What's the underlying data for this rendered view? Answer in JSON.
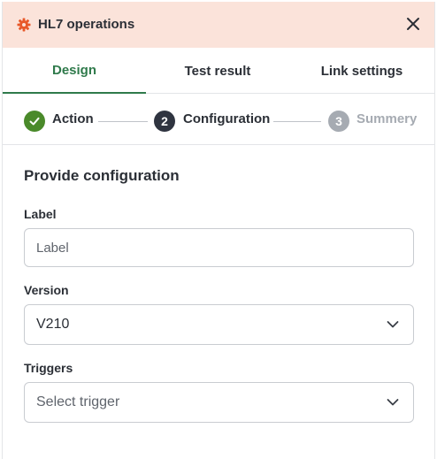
{
  "header": {
    "title": "HL7 operations",
    "icon": "gear-icon",
    "close_icon": "close-icon"
  },
  "tabs": [
    {
      "label": "Design",
      "active": true
    },
    {
      "label": "Test result",
      "active": false
    },
    {
      "label": "Link settings",
      "active": false
    }
  ],
  "steps": [
    {
      "label": "Action",
      "state": "done",
      "number": ""
    },
    {
      "label": "Configuration",
      "state": "current",
      "number": "2"
    },
    {
      "label": "Summery",
      "state": "upcoming",
      "number": "3"
    }
  ],
  "form": {
    "title": "Provide configuration",
    "label_field": {
      "label": "Label",
      "placeholder": "Label",
      "value": ""
    },
    "version_field": {
      "label": "Version",
      "value": "V210"
    },
    "triggers_field": {
      "label": "Triggers",
      "placeholder": "Select trigger"
    }
  },
  "colors": {
    "header_bg": "#fbe3da",
    "accent": "#2f7a4b",
    "gear": "#e8592a",
    "step_done": "#4a8a2a",
    "step_current": "#2f3440",
    "step_upcoming": "#a6abb2"
  }
}
